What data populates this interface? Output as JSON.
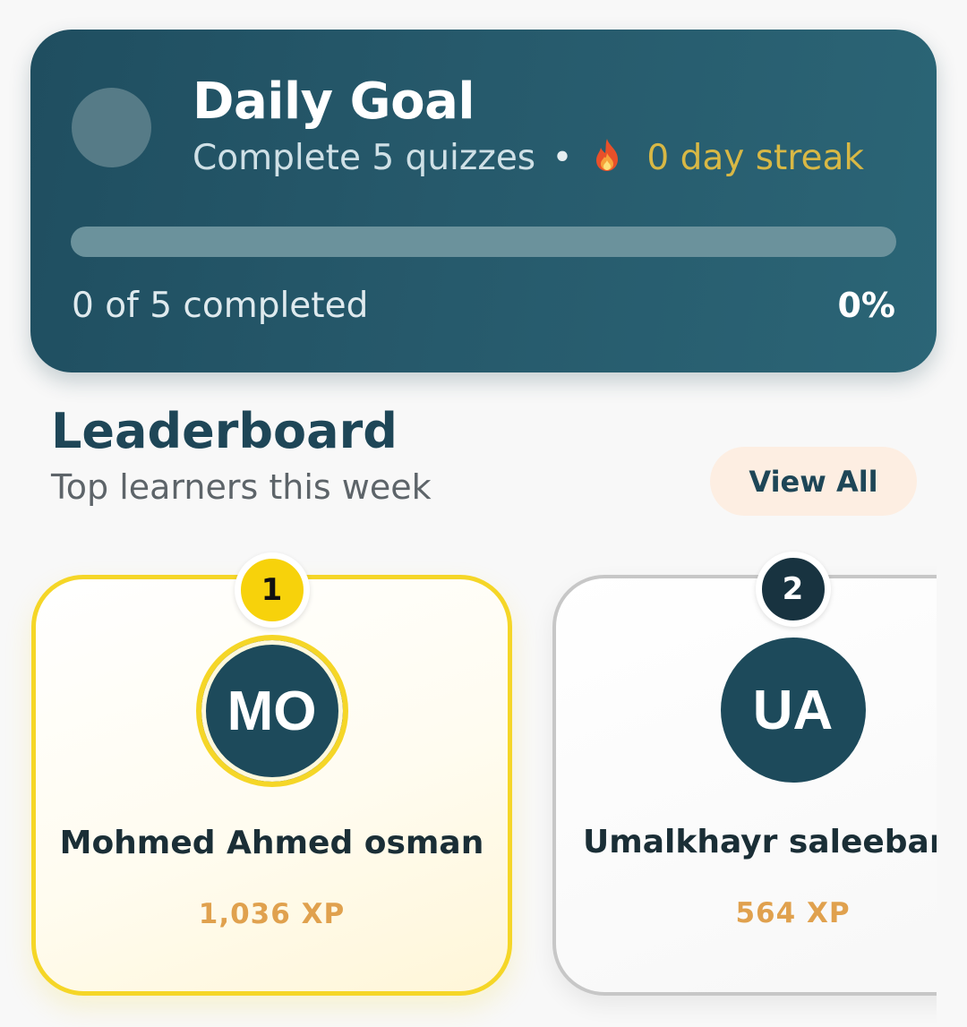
{
  "daily_goal": {
    "title": "Daily Goal",
    "subtitle_text": "Complete 5 quizzes",
    "separator": "•",
    "streak_icon": "fire-icon",
    "streak_text": "0 day streak",
    "progress_text": "0 of 5 completed",
    "percent_label": "0%",
    "progress_fraction": 0
  },
  "leaderboard": {
    "title": "Leaderboard",
    "subtitle": "Top learners this week",
    "view_all_label": "View All",
    "entries": [
      {
        "rank": "1",
        "initials": "MO",
        "name": "Mohmed Ahmed osman",
        "xp": "1,036 XP"
      },
      {
        "rank": "2",
        "initials": "UA",
        "name": "Umalkhayr saleeban",
        "xp": "564 XP"
      }
    ]
  },
  "colors": {
    "card_bg": "#26596b",
    "accent_gold": "#f5d627",
    "xp_orange": "#e0a14e",
    "streak_yellow": "#d8b845",
    "navy": "#1d4a5b"
  }
}
